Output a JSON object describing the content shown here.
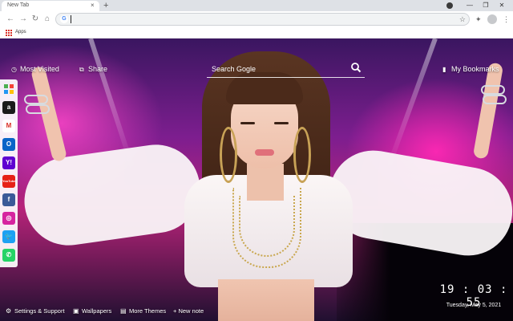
{
  "browser": {
    "tab_title": "New Tab",
    "tab_close": "×",
    "new_tab": "+",
    "omnibox_value": "",
    "bookmarks_bar": {
      "apps_label": "Apps"
    }
  },
  "overlay": {
    "most_visited": "Most Visited",
    "share": "Share",
    "search_placeholder": "Search Gogle",
    "my_bookmarks": "My Bookmarks"
  },
  "social_sidebar": [
    {
      "name": "Apps",
      "color": "#4c7bd9"
    },
    {
      "name": "Amazon",
      "label": "a",
      "color": "#1b1b1b"
    },
    {
      "name": "Gmail",
      "label": "M",
      "color": "#ffffff",
      "text_color": "#d93025"
    },
    {
      "name": "Outlook",
      "label": "O",
      "color": "#0a64c8"
    },
    {
      "name": "Yahoo",
      "label": "Y!",
      "color": "#5f01d1"
    },
    {
      "name": "YouTube",
      "label": "YouTube",
      "color": "#e62117"
    },
    {
      "name": "Facebook",
      "label": "f",
      "color": "#3b5998"
    },
    {
      "name": "Instagram",
      "label": "◎",
      "color": "#d6249f"
    },
    {
      "name": "Twitter",
      "label": "🐦",
      "color": "#1da1f2"
    },
    {
      "name": "WhatsApp",
      "label": "✆",
      "color": "#25d366"
    }
  ],
  "footer": {
    "settings": "Settings & Support",
    "wallpapers": "Wallpapers",
    "more_themes": "More Themes",
    "new_note": "+ New note"
  },
  "clock": {
    "time": "19 : 03 : 55",
    "date": "Tuesday, May 5, 2021"
  }
}
